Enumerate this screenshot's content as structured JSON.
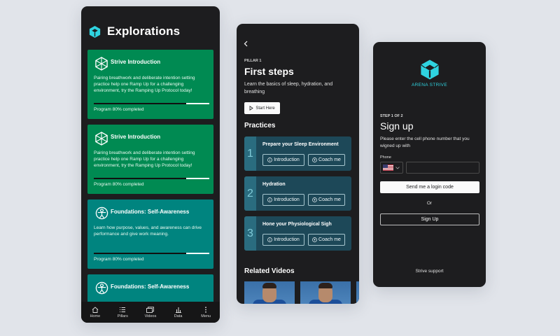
{
  "colors": {
    "background": "#e1e4ea",
    "phone": "#1d1d1f",
    "green": "#008a52",
    "teal": "#00847f",
    "practice_card": "#1d4858",
    "accent": "#2fd3e0"
  },
  "explorations": {
    "title": "Explorations",
    "cards": [
      {
        "title": "Strive Introduction",
        "description": "Pairing breathwork and deliberate intention setting practice help one Ramp Up for a challenging environment, try the Ramping Up Protocol today!",
        "progress_text": "Program 80% completed",
        "progress": 0.8,
        "color": "#008a52",
        "icon": "hexagon-icon"
      },
      {
        "title": "Strive Introduction",
        "description": "Pairing breathwork and deliberate intention setting practice help one Ramp Up for a challenging environment, try the Ramping Up Protocol today!",
        "progress_text": "Program 80% completed",
        "progress": 0.8,
        "color": "#008a52",
        "icon": "hexagon-icon"
      },
      {
        "title": "Foundations: Self-Awareness",
        "description": "Learn how purpose, values, and awareness can drive performance and give work meaning.",
        "progress_text": "Program 80% completed",
        "progress": 0.8,
        "color": "#00847f",
        "icon": "person-circle-icon"
      },
      {
        "title": "Foundations: Self-Awareness",
        "description": "",
        "progress_text": "",
        "progress": 0,
        "color": "#00847f",
        "icon": "person-circle-icon"
      }
    ],
    "tabs": [
      {
        "label": "Home",
        "icon": "home-icon"
      },
      {
        "label": "Pillars",
        "icon": "list-icon"
      },
      {
        "label": "Videos",
        "icon": "videos-icon"
      },
      {
        "label": "Data",
        "icon": "bar-chart-icon"
      },
      {
        "label": "Menu",
        "icon": "more-vertical-icon"
      }
    ]
  },
  "pillar": {
    "eyebrow": "PILLAR 1",
    "title": "First steps",
    "description": "Learn the basics of sleep, hydration, and breathing",
    "start_label": "Start Here",
    "practices_title": "Practices",
    "practices": [
      {
        "number": "1",
        "title": "Prepare your Sleep Environment",
        "intro_label": "Introduction",
        "coach_label": "Coach me"
      },
      {
        "number": "2",
        "title": "Hydration",
        "intro_label": "Introduction",
        "coach_label": "Coach me"
      },
      {
        "number": "3",
        "title": "Hone your Physiological Sigh",
        "intro_label": "Introduction",
        "coach_label": "Coach me"
      }
    ],
    "related_title": "Related Videos"
  },
  "signup": {
    "brand": "ARENA STRIVE",
    "step": "STEP 1 OF 2",
    "title": "Sign up",
    "description": "Please enter the cell phone number that you wigned up with",
    "phone_label": "Phone",
    "phone_value": "",
    "login_button": "Send me a login code",
    "or_text": "Or",
    "signup_button": "Sign Up",
    "support_link": "Strive support"
  }
}
